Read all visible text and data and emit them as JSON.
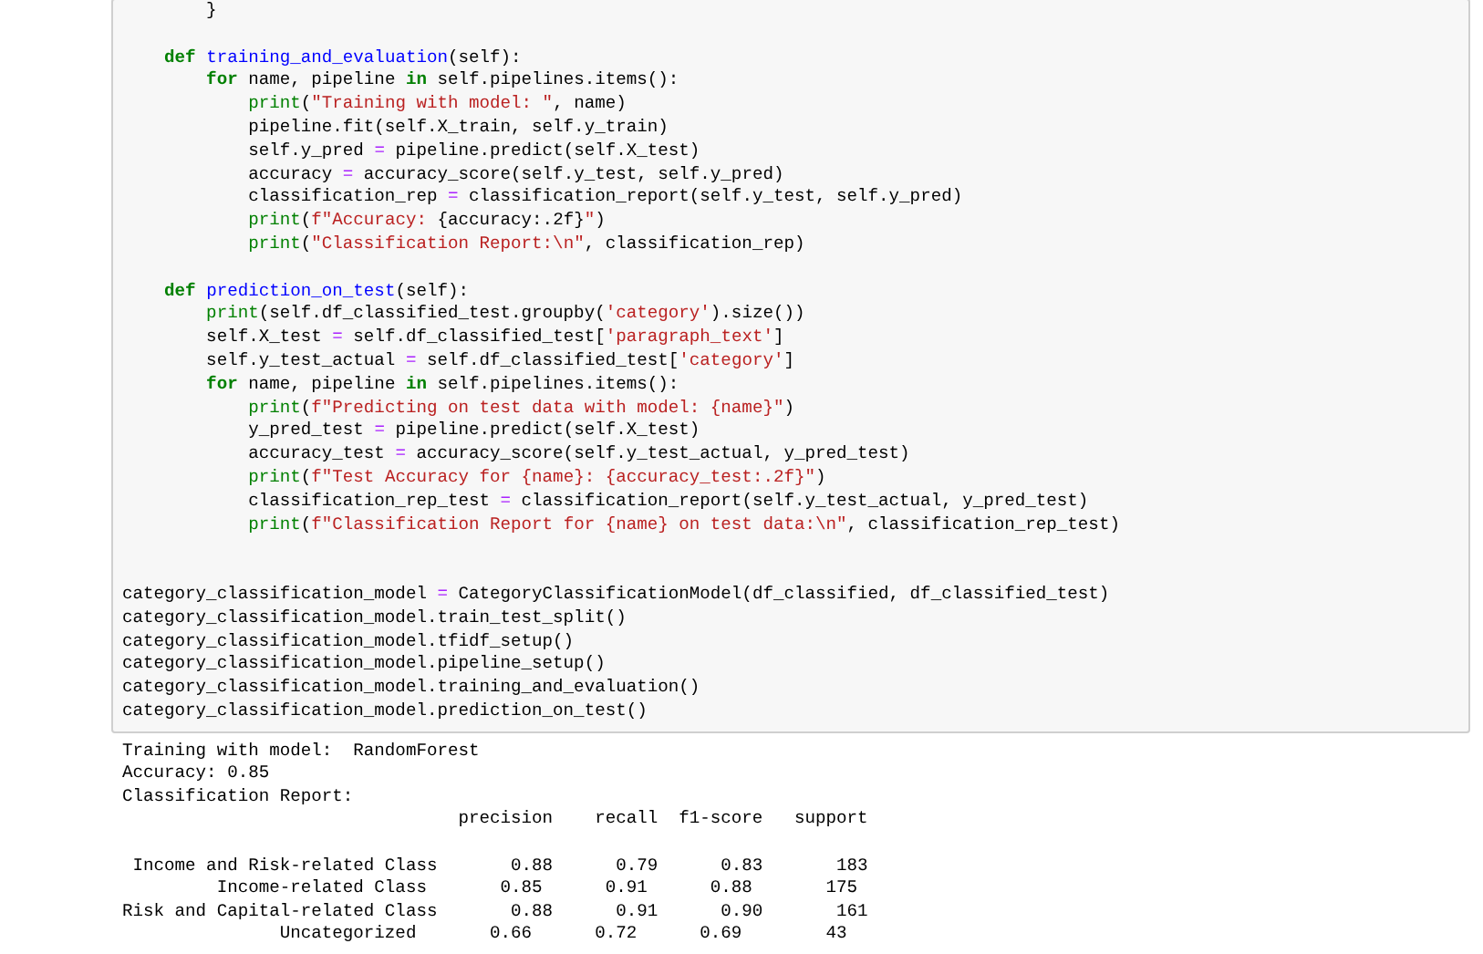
{
  "code_cell": {
    "lines": [
      {
        "blank_before": false,
        "double_blank": false,
        "segments": [
          {
            "text": "        }",
            "kind": "plain"
          }
        ]
      },
      {
        "blank_before": true,
        "double_blank": false,
        "segments": [
          {
            "text": "    def",
            "kind": "keyword"
          },
          {
            "text": " training_and_evaluation",
            "kind": "defname"
          },
          {
            "text": "(self):",
            "kind": "plain"
          }
        ]
      },
      {
        "blank_before": false,
        "double_blank": false,
        "segments": [
          {
            "text": "        for",
            "kind": "keyword"
          },
          {
            "text": " name, pipeline ",
            "kind": "plain"
          },
          {
            "text": "in",
            "kind": "keyword"
          },
          {
            "text": " self.pipelines.items():",
            "kind": "plain"
          }
        ]
      },
      {
        "blank_before": false,
        "double_blank": false,
        "segments": [
          {
            "text": "            print",
            "kind": "builtin"
          },
          {
            "text": "(",
            "kind": "plain"
          },
          {
            "text": "\"Training with model: \"",
            "kind": "string"
          },
          {
            "text": ", name)",
            "kind": "plain"
          }
        ]
      },
      {
        "blank_before": false,
        "double_blank": false,
        "segments": [
          {
            "text": "            pipeline.fit(self.X_train, self.y_train)",
            "kind": "plain"
          }
        ]
      },
      {
        "blank_before": false,
        "double_blank": false,
        "segments": [
          {
            "text": "            self.y_pred ",
            "kind": "plain"
          },
          {
            "text": "=",
            "kind": "operator"
          },
          {
            "text": " pipeline.predict(self.X_test)",
            "kind": "plain"
          }
        ]
      },
      {
        "blank_before": false,
        "double_blank": false,
        "segments": [
          {
            "text": "            accuracy ",
            "kind": "plain"
          },
          {
            "text": "=",
            "kind": "operator"
          },
          {
            "text": " accuracy_score(self.y_test, self.y_pred)",
            "kind": "plain"
          }
        ]
      },
      {
        "blank_before": false,
        "double_blank": false,
        "segments": [
          {
            "text": "            classification_rep ",
            "kind": "plain"
          },
          {
            "text": "=",
            "kind": "operator"
          },
          {
            "text": " classification_report(self.y_test, self.y_pred)",
            "kind": "plain"
          }
        ]
      },
      {
        "blank_before": false,
        "double_blank": false,
        "segments": [
          {
            "text": "            print",
            "kind": "builtin"
          },
          {
            "text": "(",
            "kind": "plain"
          },
          {
            "text": "f\"Accuracy: ",
            "kind": "string"
          },
          {
            "text": "{accuracy:.2f}",
            "kind": "plain"
          },
          {
            "text": "\"",
            "kind": "string"
          },
          {
            "text": ")",
            "kind": "plain"
          }
        ]
      },
      {
        "blank_before": false,
        "double_blank": false,
        "segments": [
          {
            "text": "            print",
            "kind": "builtin"
          },
          {
            "text": "(",
            "kind": "plain"
          },
          {
            "text": "\"Classification Report:\\n\"",
            "kind": "string"
          },
          {
            "text": ", classification_rep)",
            "kind": "plain"
          }
        ]
      },
      {
        "blank_before": true,
        "double_blank": false,
        "segments": [
          {
            "text": "    def",
            "kind": "keyword"
          },
          {
            "text": " prediction_on_test",
            "kind": "defname"
          },
          {
            "text": "(self):",
            "kind": "plain"
          }
        ]
      },
      {
        "blank_before": false,
        "double_blank": false,
        "segments": [
          {
            "text": "        print",
            "kind": "builtin"
          },
          {
            "text": "(self.df_classified_test.groupby(",
            "kind": "plain"
          },
          {
            "text": "'category'",
            "kind": "string"
          },
          {
            "text": ").size())",
            "kind": "plain"
          }
        ]
      },
      {
        "blank_before": false,
        "double_blank": false,
        "segments": [
          {
            "text": "        self.X_test ",
            "kind": "plain"
          },
          {
            "text": "=",
            "kind": "operator"
          },
          {
            "text": " self.df_classified_test[",
            "kind": "plain"
          },
          {
            "text": "'paragraph_text'",
            "kind": "string"
          },
          {
            "text": "]",
            "kind": "plain"
          }
        ]
      },
      {
        "blank_before": false,
        "double_blank": false,
        "segments": [
          {
            "text": "        self.y_test_actual ",
            "kind": "plain"
          },
          {
            "text": "=",
            "kind": "operator"
          },
          {
            "text": " self.df_classified_test[",
            "kind": "plain"
          },
          {
            "text": "'category'",
            "kind": "string"
          },
          {
            "text": "]",
            "kind": "plain"
          }
        ]
      },
      {
        "blank_before": false,
        "double_blank": false,
        "segments": [
          {
            "text": "        for",
            "kind": "keyword"
          },
          {
            "text": " name, pipeline ",
            "kind": "plain"
          },
          {
            "text": "in",
            "kind": "keyword"
          },
          {
            "text": " self.pipelines.items():",
            "kind": "plain"
          }
        ]
      },
      {
        "blank_before": false,
        "double_blank": false,
        "segments": [
          {
            "text": "            print",
            "kind": "builtin"
          },
          {
            "text": "(",
            "kind": "plain"
          },
          {
            "text": "f\"Predicting on test data with model: {name}\"",
            "kind": "string"
          },
          {
            "text": ")",
            "kind": "plain"
          }
        ]
      },
      {
        "blank_before": false,
        "double_blank": false,
        "segments": [
          {
            "text": "            y_pred_test ",
            "kind": "plain"
          },
          {
            "text": "=",
            "kind": "operator"
          },
          {
            "text": " pipeline.predict(self.X_test)",
            "kind": "plain"
          }
        ]
      },
      {
        "blank_before": false,
        "double_blank": false,
        "segments": [
          {
            "text": "            accuracy_test ",
            "kind": "plain"
          },
          {
            "text": "=",
            "kind": "operator"
          },
          {
            "text": " accuracy_score(self.y_test_actual, y_pred_test)",
            "kind": "plain"
          }
        ]
      },
      {
        "blank_before": false,
        "double_blank": false,
        "segments": [
          {
            "text": "            print",
            "kind": "builtin"
          },
          {
            "text": "(",
            "kind": "plain"
          },
          {
            "text": "f\"Test Accuracy for {name}: {accuracy_test:.2f}\"",
            "kind": "string"
          },
          {
            "text": ")",
            "kind": "plain"
          }
        ]
      },
      {
        "blank_before": false,
        "double_blank": false,
        "segments": [
          {
            "text": "            classification_rep_test ",
            "kind": "plain"
          },
          {
            "text": "=",
            "kind": "operator"
          },
          {
            "text": " classification_report(self.y_test_actual, y_pred_test)",
            "kind": "plain"
          }
        ]
      },
      {
        "blank_before": false,
        "double_blank": false,
        "segments": [
          {
            "text": "            print",
            "kind": "builtin"
          },
          {
            "text": "(",
            "kind": "plain"
          },
          {
            "text": "f\"Classification Report for {name} on test data:\\n\"",
            "kind": "string"
          },
          {
            "text": ", classification_rep_test)",
            "kind": "plain"
          }
        ]
      },
      {
        "blank_before": true,
        "double_blank": true,
        "segments": [
          {
            "text": "category_classification_model ",
            "kind": "plain"
          },
          {
            "text": "=",
            "kind": "operator"
          },
          {
            "text": " CategoryClassificationModel(df_classified, df_classified_test)",
            "kind": "plain"
          }
        ]
      },
      {
        "blank_before": false,
        "double_blank": false,
        "segments": [
          {
            "text": "category_classification_model.train_test_split()",
            "kind": "plain"
          }
        ]
      },
      {
        "blank_before": false,
        "double_blank": false,
        "segments": [
          {
            "text": "category_classification_model.tfidf_setup()",
            "kind": "plain"
          }
        ]
      },
      {
        "blank_before": false,
        "double_blank": false,
        "segments": [
          {
            "text": "category_classification_model.pipeline_setup()",
            "kind": "plain"
          }
        ]
      },
      {
        "blank_before": false,
        "double_blank": false,
        "segments": [
          {
            "text": "category_classification_model.training_and_evaluation()",
            "kind": "plain"
          }
        ]
      },
      {
        "blank_before": false,
        "double_blank": false,
        "segments": [
          {
            "text": "category_classification_model.prediction_on_test()",
            "kind": "plain"
          }
        ]
      }
    ]
  },
  "output": {
    "lines": [
      {
        "blank_before": false,
        "text": "Training with model:  RandomForest"
      },
      {
        "blank_before": false,
        "text": "Accuracy: 0.85"
      },
      {
        "blank_before": false,
        "text": "Classification Report:"
      },
      {
        "blank_before": false,
        "text": "                                precision    recall  f1-score   support"
      },
      {
        "blank_before": true,
        "text": " Income and Risk-related Class       0.88      0.79      0.83       183"
      },
      {
        "blank_before": false,
        "text": "         Income-related Class       0.85      0.91      0.88       175"
      },
      {
        "blank_before": false,
        "text": "Risk and Capital-related Class       0.88      0.91      0.90       161"
      },
      {
        "blank_before": false,
        "text": "               Uncategorized       0.66      0.72      0.69        43"
      }
    ]
  }
}
